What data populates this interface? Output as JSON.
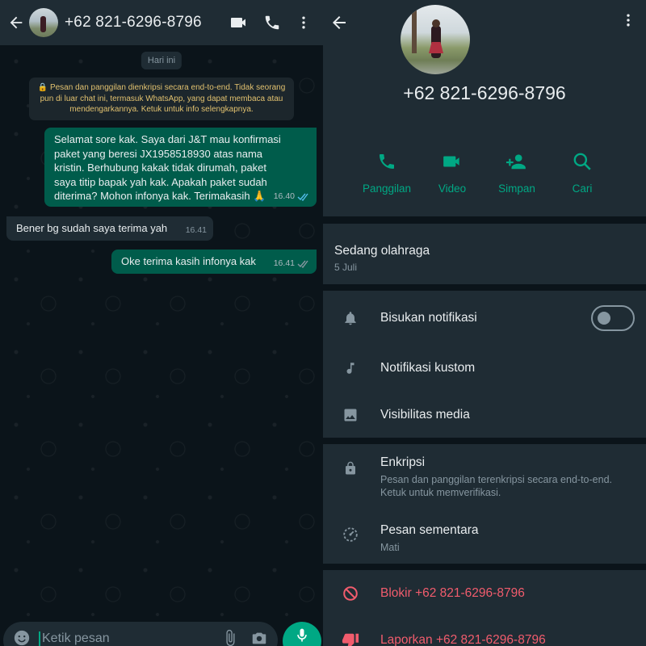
{
  "chat": {
    "title": "+62 821-6296-8796",
    "date_chip": "Hari ini",
    "encryption_notice": "🔒 Pesan dan panggilan dienkripsi secara end-to-end. Tidak seorang pun di luar chat ini, termasuk WhatsApp, yang dapat membaca atau mendengarkannya. Ketuk untuk info selengkapnya.",
    "messages": [
      {
        "direction": "out",
        "text": "Selamat sore kak. Saya dari J&T mau konfirmasi paket yang beresi JX1958518930 atas nama kristin. Berhubung kakak tidak dirumah, paket saya titip bapak yah kak. Apakah paket sudah diterima? Mohon infonya kak. Terimakasih 🙏",
        "time": "16.40",
        "status": "read"
      },
      {
        "direction": "in",
        "text": "Bener bg sudah saya terima yah",
        "time": "16.41"
      },
      {
        "direction": "out",
        "text": "Oke terima kasih infonya kak",
        "time": "16.41",
        "status": "read"
      }
    ],
    "input_placeholder": "Ketik pesan"
  },
  "info": {
    "name": "+62 821-6296-8796",
    "actions": [
      {
        "label": "Panggilan",
        "icon": "phone-icon"
      },
      {
        "label": "Video",
        "icon": "video-icon"
      },
      {
        "label": "Simpan",
        "icon": "add-person-icon"
      },
      {
        "label": "Cari",
        "icon": "search-icon"
      }
    ],
    "about": {
      "text": "Sedang olahraga",
      "date": "5 Juli"
    },
    "mute_label": "Bisukan notifikasi",
    "mute_on": false,
    "custom_notif_label": "Notifikasi kustom",
    "media_visibility_label": "Visibilitas media",
    "encryption": {
      "title": "Enkripsi",
      "subtitle": "Pesan dan panggilan terenkripsi secara end-to-end. Ketuk untuk memverifikasi."
    },
    "disappearing": {
      "title": "Pesan sementara",
      "subtitle": "Mati"
    },
    "block_label": "Blokir +62 821-6296-8796",
    "report_label": "Laporkan +62 821-6296-8796"
  },
  "colors": {
    "accent": "#00a884",
    "outgoing_bubble": "#005c4b",
    "incoming_bubble": "#1f2c34",
    "danger": "#f15c6d",
    "read_ticks": "#53bdeb"
  }
}
